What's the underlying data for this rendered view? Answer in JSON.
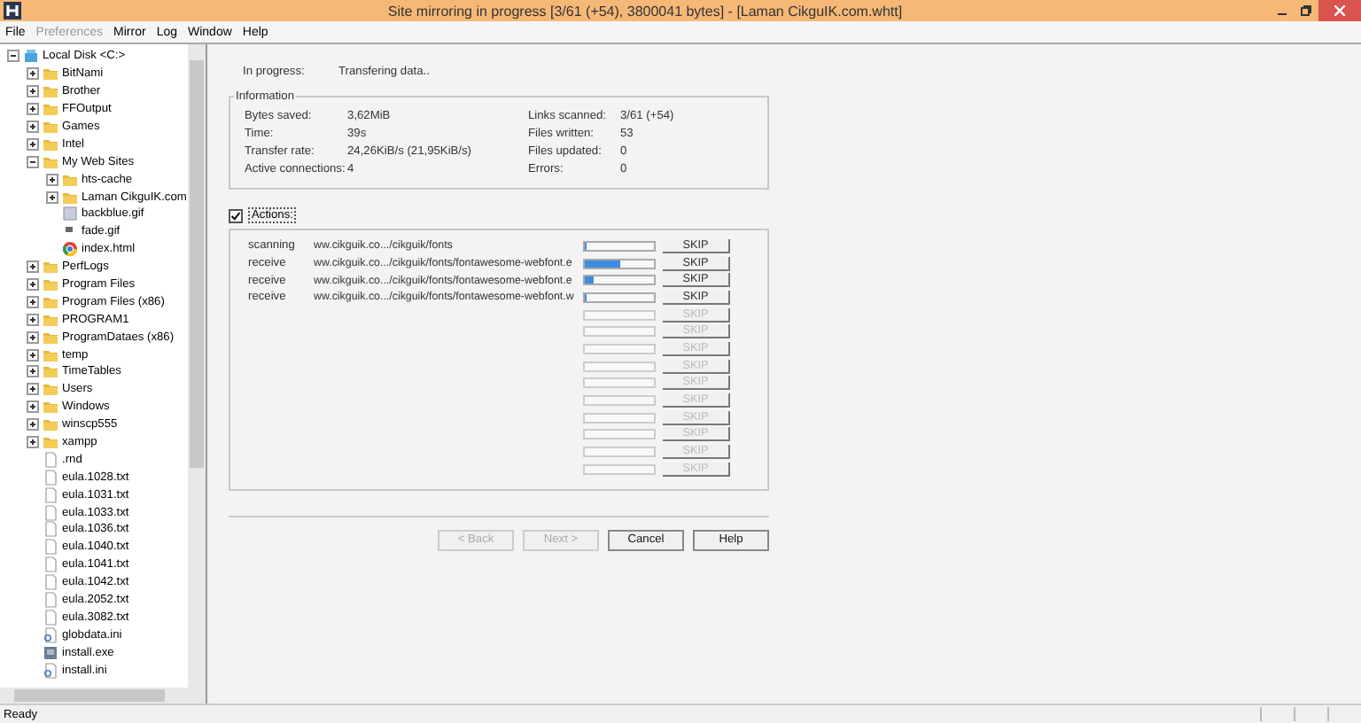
{
  "window": {
    "title": "Site mirroring in progress [3/61 (+54), 3800041 bytes] - [Laman CikguIK.com.whtt]"
  },
  "menu": [
    {
      "label": "File",
      "disabled": false
    },
    {
      "label": "Preferences",
      "disabled": true
    },
    {
      "label": "Mirror",
      "disabled": false
    },
    {
      "label": "Log",
      "disabled": false
    },
    {
      "label": "Window",
      "disabled": false
    },
    {
      "label": "Help",
      "disabled": false
    }
  ],
  "tree": [
    {
      "label": "Local Disk <C:>",
      "kind": "drive",
      "expanded": true,
      "children": [
        {
          "label": "BitNami",
          "kind": "folder",
          "expanded": false
        },
        {
          "label": "Brother",
          "kind": "folder",
          "expanded": false
        },
        {
          "label": "FFOutput",
          "kind": "folder",
          "expanded": false
        },
        {
          "label": "Games",
          "kind": "folder",
          "expanded": false
        },
        {
          "label": "Intel",
          "kind": "folder",
          "expanded": false
        },
        {
          "label": "My Web Sites",
          "kind": "folder",
          "expanded": true,
          "children": [
            {
              "label": "hts-cache",
              "kind": "folder",
              "expanded": false
            },
            {
              "label": "Laman CikguIK.com",
              "kind": "folder",
              "expanded": false
            },
            {
              "label": "backblue.gif",
              "kind": "image"
            },
            {
              "label": "fade.gif",
              "kind": "small"
            },
            {
              "label": "index.html",
              "kind": "web"
            }
          ]
        },
        {
          "label": "PerfLogs",
          "kind": "folder",
          "expanded": false
        },
        {
          "label": "Program Files",
          "kind": "folder",
          "expanded": false
        },
        {
          "label": "Program Files (x86)",
          "kind": "folder",
          "expanded": false
        },
        {
          "label": "PROGRAM1",
          "kind": "folder",
          "expanded": false
        },
        {
          "label": "ProgramDataes (x86)",
          "kind": "folder",
          "expanded": false
        },
        {
          "label": "temp",
          "kind": "folder",
          "expanded": false
        },
        {
          "label": "TimeTables",
          "kind": "folder",
          "expanded": false
        },
        {
          "label": "Users",
          "kind": "folder",
          "expanded": false
        },
        {
          "label": "Windows",
          "kind": "folder",
          "expanded": false
        },
        {
          "label": "winscp555",
          "kind": "folder",
          "expanded": false
        },
        {
          "label": "xampp",
          "kind": "folder",
          "expanded": false
        },
        {
          "label": ".rnd",
          "kind": "file"
        },
        {
          "label": "eula.1028.txt",
          "kind": "file"
        },
        {
          "label": "eula.1031.txt",
          "kind": "file"
        },
        {
          "label": "eula.1033.txt",
          "kind": "file"
        },
        {
          "label": "eula.1036.txt",
          "kind": "file"
        },
        {
          "label": "eula.1040.txt",
          "kind": "file"
        },
        {
          "label": "eula.1041.txt",
          "kind": "file"
        },
        {
          "label": "eula.1042.txt",
          "kind": "file"
        },
        {
          "label": "eula.2052.txt",
          "kind": "file"
        },
        {
          "label": "eula.3082.txt",
          "kind": "file"
        },
        {
          "label": "globdata.ini",
          "kind": "ini"
        },
        {
          "label": "install.exe",
          "kind": "exe"
        },
        {
          "label": "install.ini",
          "kind": "ini"
        }
      ]
    }
  ],
  "progress": {
    "label": "In progress:",
    "value": "Transfering data.."
  },
  "information": {
    "title": "Information",
    "left": [
      {
        "label": "Bytes saved:",
        "value": "3,62MiB"
      },
      {
        "label": "Time:",
        "value": "39s"
      },
      {
        "label": "Transfer rate:",
        "value": "24,26KiB/s (21,95KiB/s)"
      },
      {
        "label": "Active connections:",
        "value": "4"
      }
    ],
    "right": [
      {
        "label": "Links scanned:",
        "value": "3/61 (+54)"
      },
      {
        "label": "Files written:",
        "value": "53"
      },
      {
        "label": "Files updated:",
        "value": "0"
      },
      {
        "label": "Errors:",
        "value": "0"
      }
    ]
  },
  "actions": {
    "label": "Actions:",
    "checked": true,
    "rows": [
      {
        "status": "scanning",
        "url": "ww.cikguik.co.../cikguik/fonts",
        "level": 0.03,
        "button": "SKIP",
        "disabled": false
      },
      {
        "status": "receive",
        "url": "ww.cikguik.co.../cikguik/fonts/fontawesome-webfont.e",
        "level": 0.52,
        "button": "SKIP",
        "disabled": false
      },
      {
        "status": "receive",
        "url": "ww.cikguik.co.../cikguik/fonts/fontawesome-webfont.e",
        "level": 0.12,
        "button": "SKIP",
        "disabled": false
      },
      {
        "status": "receive",
        "url": "ww.cikguik.co.../cikguik/fonts/fontawesome-webfont.w",
        "level": 0.03,
        "button": "SKIP",
        "disabled": false
      },
      {
        "button": "SKIP",
        "disabled": true
      },
      {
        "button": "SKIP",
        "disabled": true
      },
      {
        "button": "SKIP",
        "disabled": true
      },
      {
        "button": "SKIP",
        "disabled": true
      },
      {
        "button": "SKIP",
        "disabled": true
      },
      {
        "button": "SKIP",
        "disabled": true
      },
      {
        "button": "SKIP",
        "disabled": true
      },
      {
        "button": "SKIP",
        "disabled": true
      },
      {
        "button": "SKIP",
        "disabled": true
      },
      {
        "button": "SKIP",
        "disabled": true
      }
    ]
  },
  "buttons": [
    {
      "label": "< Back",
      "disabled": true
    },
    {
      "label": "Next >",
      "disabled": true
    },
    {
      "label": "Cancel",
      "disabled": false
    },
    {
      "label": "Help",
      "disabled": false
    }
  ],
  "status_bar": {
    "text": "Ready"
  }
}
